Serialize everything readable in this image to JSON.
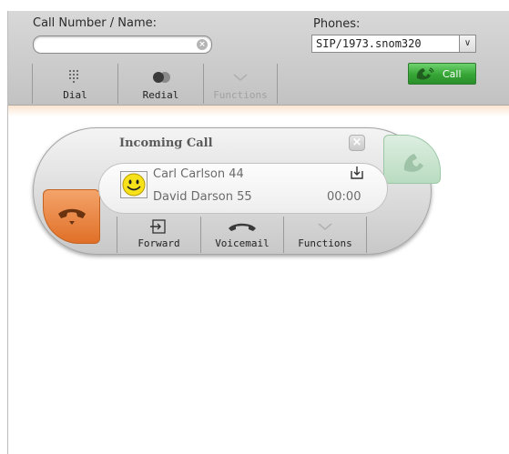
{
  "toolbar": {
    "call_number_label": "Call Number / Name:",
    "search_value": "",
    "phones_label": "Phones:",
    "phone_selected": "SIP/1973.snom320",
    "call_button": "Call",
    "dial_label": "Dial",
    "redial_label": "Redial",
    "functions_label": "Functions"
  },
  "incoming": {
    "title": "Incoming Call",
    "caller": "Carl Carlson 44",
    "callee": "David Darson 55",
    "duration": "00:00",
    "forward_label": "Forward",
    "voicemail_label": "Voicemail",
    "functions_label": "Functions"
  },
  "colors": {
    "call_green": "#35a535",
    "hangup_orange": "#e07028",
    "answer_green_disabled": "#b9dcc0"
  },
  "icons": {
    "dial": "keypad-icon",
    "redial": "redial-icon",
    "functions": "chevron-down-icon",
    "call": "phone-handset-icon",
    "forward": "forward-icon",
    "voicemail": "voicemail-icon",
    "transfer": "transfer-icon",
    "close": "close-icon",
    "answer": "answer-icon",
    "hangup": "hangup-icon"
  }
}
